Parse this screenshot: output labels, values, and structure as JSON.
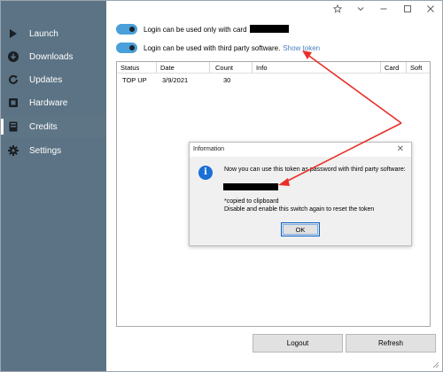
{
  "sidebar": {
    "items": [
      {
        "label": "Launch",
        "icon": "play-icon"
      },
      {
        "label": "Downloads",
        "icon": "download-icon"
      },
      {
        "label": "Updates",
        "icon": "refresh-icon"
      },
      {
        "label": "Hardware",
        "icon": "hardware-icon"
      },
      {
        "label": "Credits",
        "icon": "credits-icon",
        "active": true
      },
      {
        "label": "Settings",
        "icon": "gear-icon"
      }
    ],
    "background": "#5b7384"
  },
  "titlebar": {
    "buttons": [
      "pin-icon",
      "collapse-icon",
      "minimize-icon",
      "maximize-icon",
      "close-icon"
    ]
  },
  "options": {
    "card_login_label": "Login can be used only with card",
    "third_party_label": "Login can be used with third party software.",
    "show_token_link": "Show token"
  },
  "table": {
    "columns": [
      "Status",
      "Date",
      "Count",
      "Info",
      "Card",
      "Soft"
    ],
    "rows": [
      {
        "status": "TOP UP",
        "date": "3/9/2021",
        "count": "30",
        "info": "",
        "card": "",
        "soft": ""
      }
    ]
  },
  "dialog": {
    "title": "Information",
    "message": "Now you can use this token as password with third party software:",
    "note_line1": "*copied to clipboard",
    "note_line2": "Disable and enable this switch again to reset the token",
    "ok_label": "OK"
  },
  "footer": {
    "logout_label": "Logout",
    "refresh_label": "Refresh"
  },
  "colors": {
    "accent": "#4aa0d8",
    "link": "#4a7fbf",
    "annotation_arrow": "#e8302a",
    "info_icon": "#1b6fd6"
  }
}
